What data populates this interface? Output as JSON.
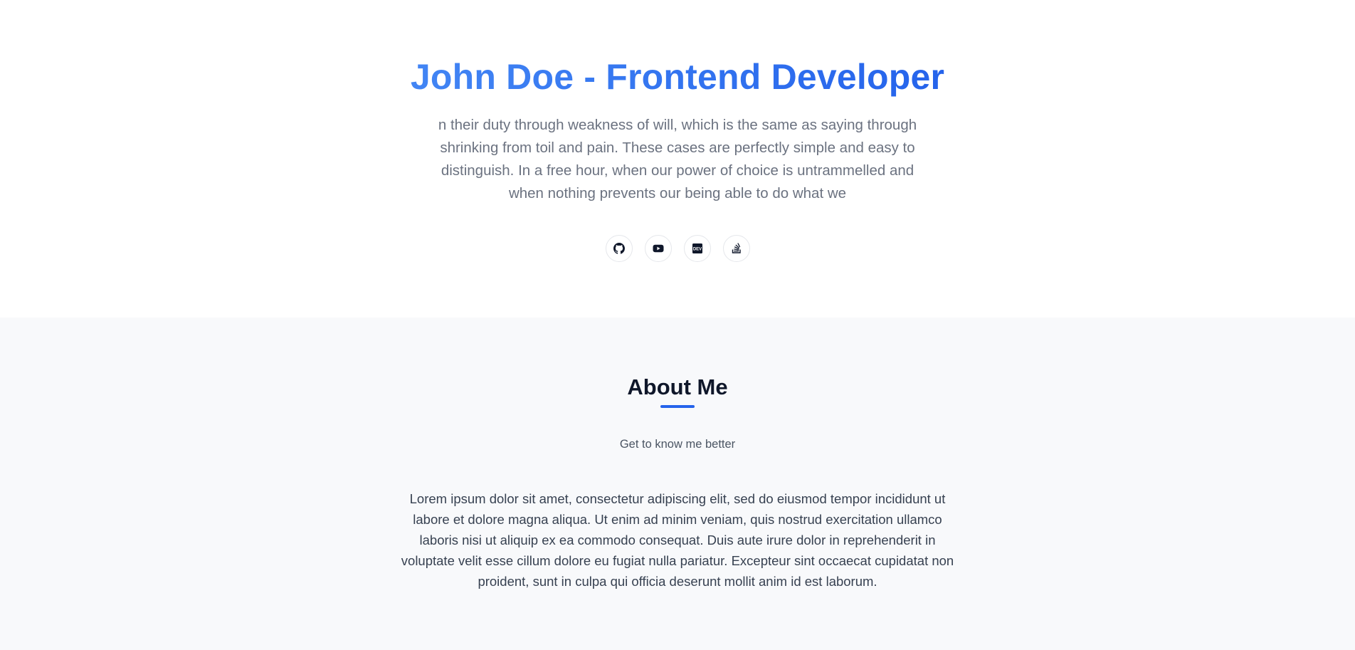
{
  "hero": {
    "title": "John Doe - Frontend Developer",
    "bio": "n their duty through weakness of will, which is the same as saying through shrinking from toil and pain. These cases are perfectly simple and easy to distinguish. In a free hour, when our power of choice is untrammelled and when nothing prevents our being able to do what we",
    "socials": [
      {
        "icon": "github-icon"
      },
      {
        "icon": "youtube-icon"
      },
      {
        "icon": "dev-icon"
      },
      {
        "icon": "stackoverflow-icon"
      }
    ]
  },
  "about": {
    "title": "About Me",
    "subtitle": "Get to know me better",
    "body": "Lorem ipsum dolor sit amet, consectetur adipiscing elit, sed do eiusmod tempor incididunt ut labore et dolore magna aliqua. Ut enim ad minim veniam, quis nostrud exercitation ullamco laboris nisi ut aliquip ex ea commodo consequat. Duis aute irure dolor in reprehenderit in voluptate velit esse cillum dolore eu fugiat nulla pariatur. Excepteur sint occaecat cupidatat non proident, sunt in culpa qui officia deserunt mollit anim id est laborum."
  },
  "colors": {
    "accent": "#2563eb",
    "title_gradient_start": "#4285f4",
    "text_muted": "#6b7280",
    "heading": "#0f172a",
    "section_bg": "#f8f9fb"
  }
}
